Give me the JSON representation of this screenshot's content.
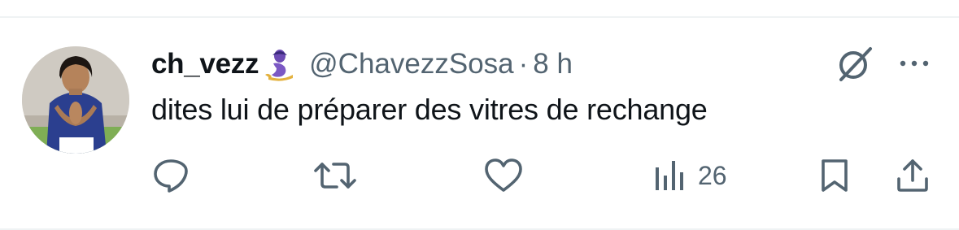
{
  "tweet": {
    "display_name": "ch_vezz",
    "handle": "@ChavezzSosa",
    "separator": "·",
    "time": "8 h",
    "text": "dites lui de préparer des vitres de rechange"
  },
  "actions": {
    "reply_icon": "reply-icon",
    "retweet_icon": "retweet-icon",
    "like_icon": "like-icon",
    "views_icon": "views-icon",
    "views_count": "26",
    "bookmark_icon": "bookmark-icon",
    "share_icon": "share-icon"
  },
  "colors": {
    "text_primary": "#0f1419",
    "text_secondary": "#536471",
    "divider": "#eff3f4"
  }
}
